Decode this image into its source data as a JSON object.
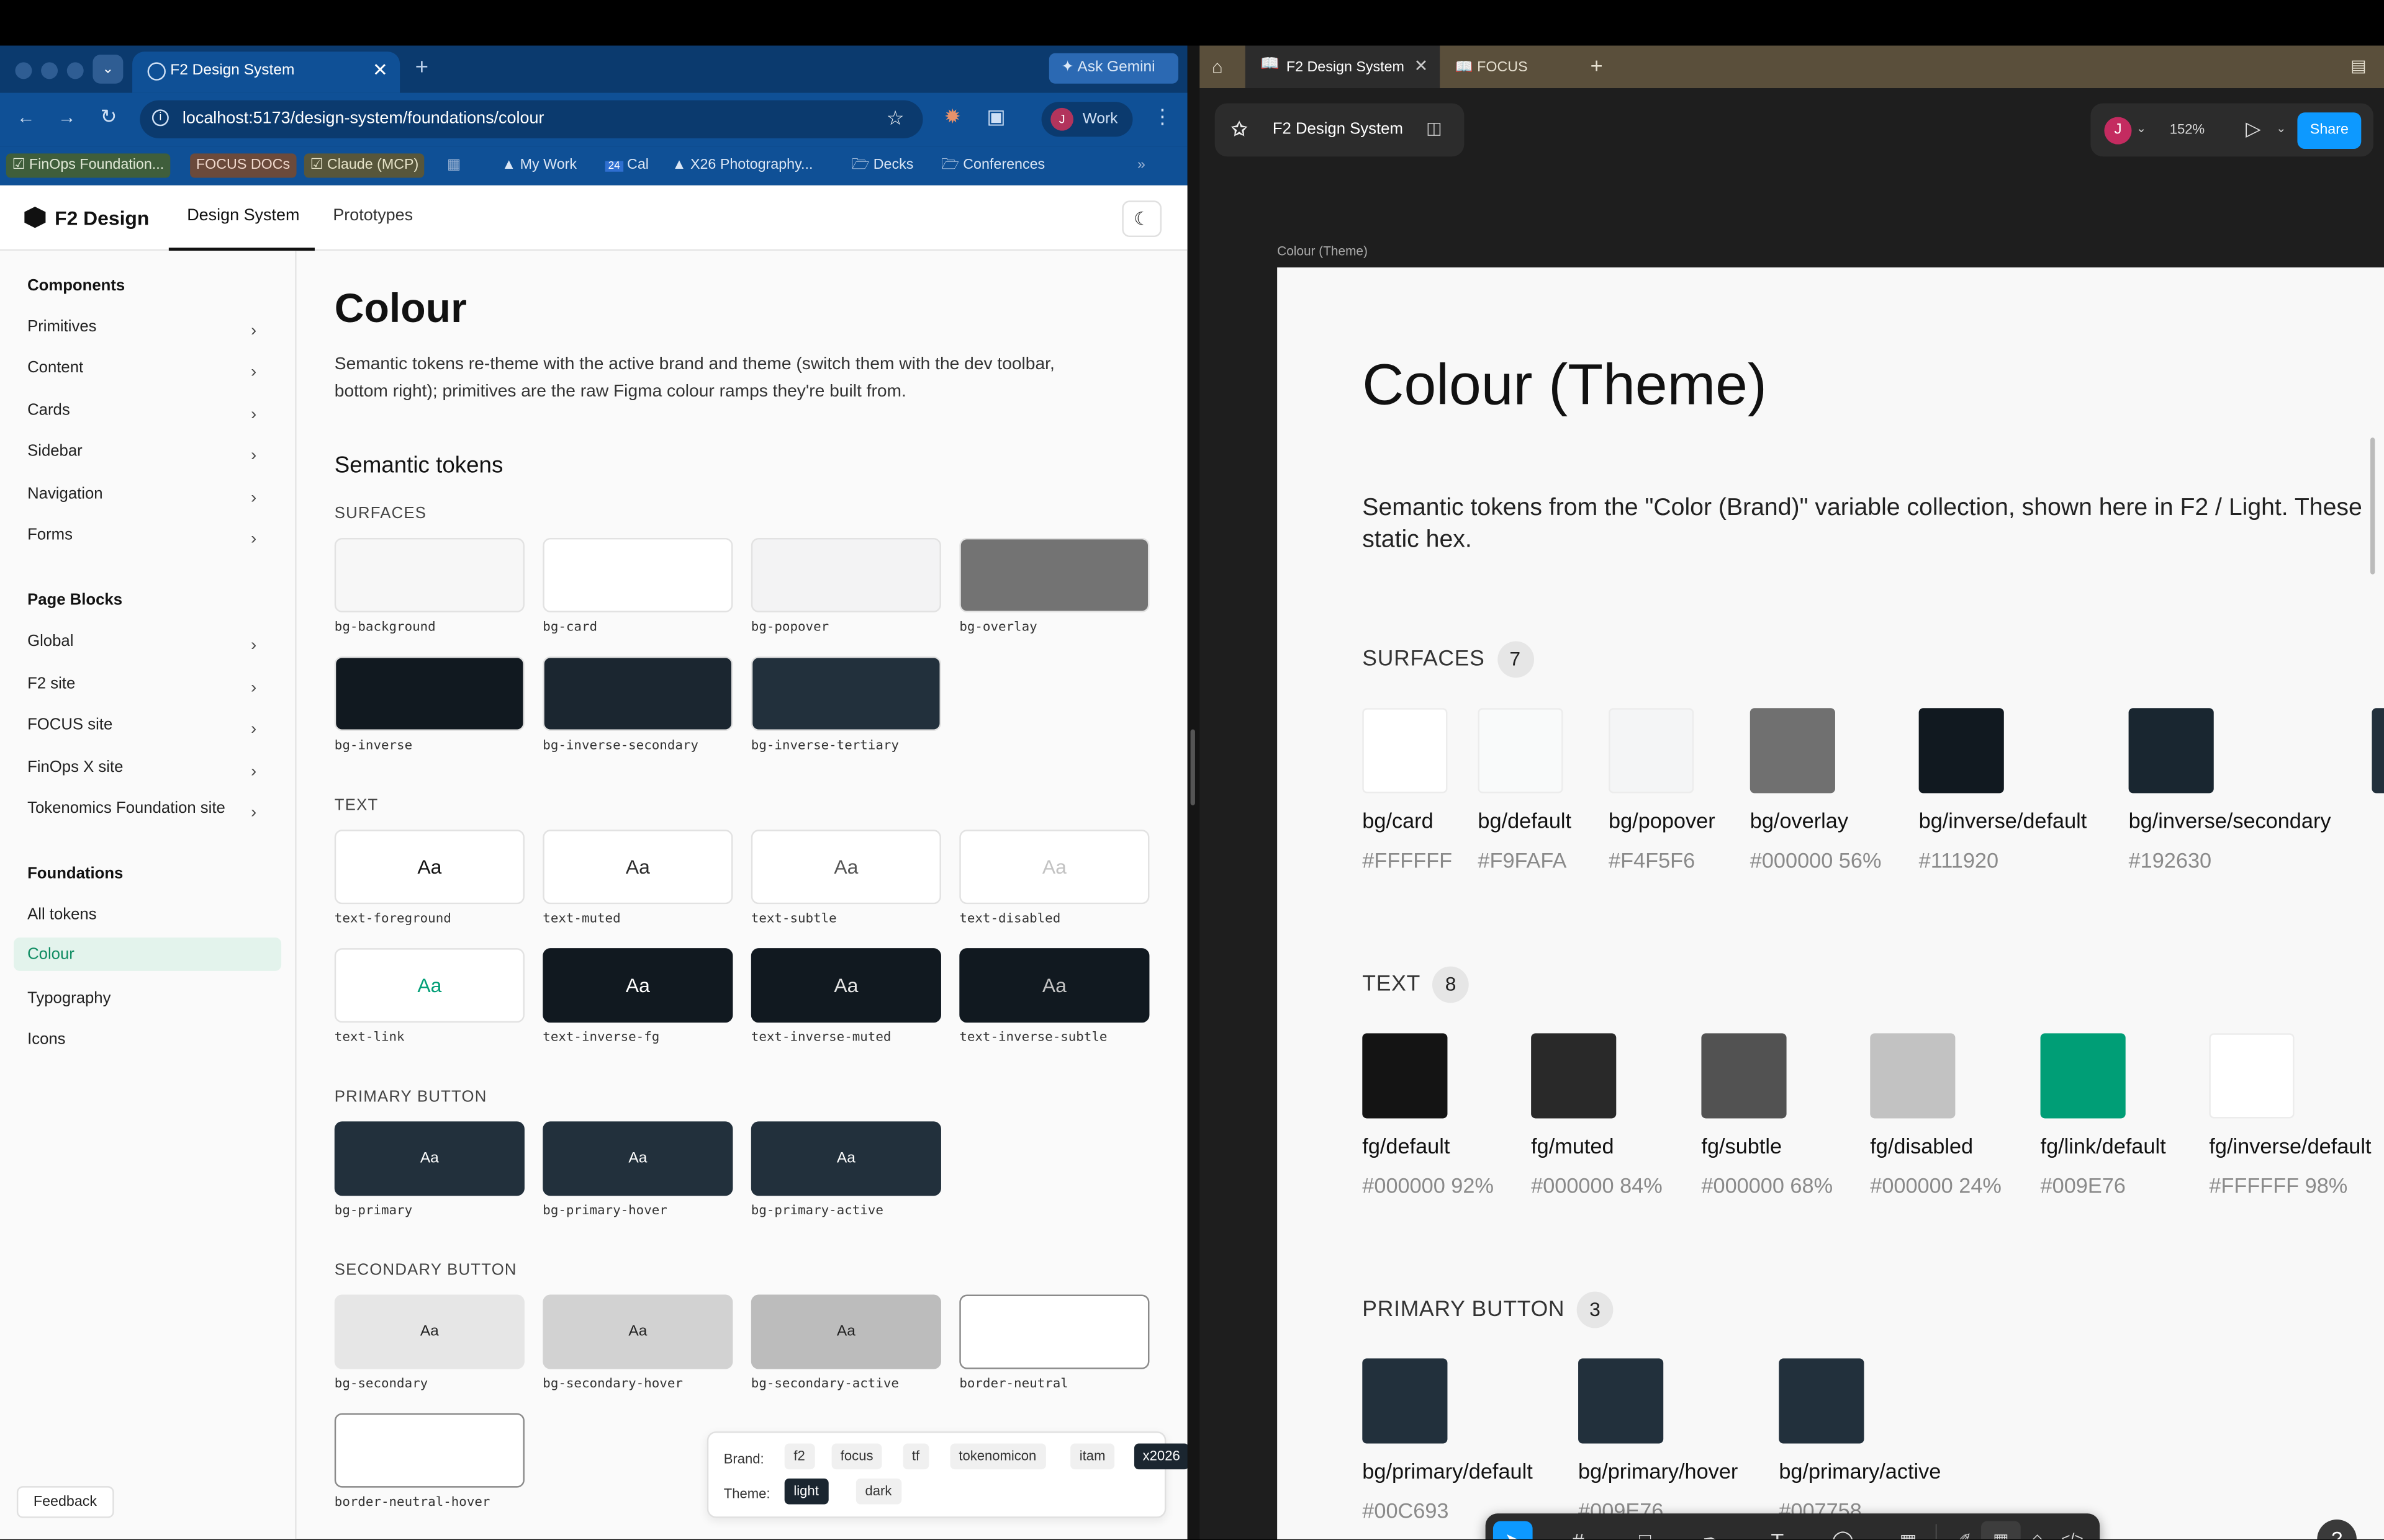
{
  "browser": {
    "tab_title": "F2 Design System",
    "ask_gemini": "Ask Gemini",
    "url": "localhost:5173/design-system/foundations/colour",
    "profile_initial": "J",
    "profile_label": "Work",
    "bookmarks": [
      "FinOps Foundation...",
      "FOCUS DOCs",
      "Claude (MCP)",
      "My Work",
      "Cal",
      "X26 Photography...",
      "Decks",
      "Conferences"
    ],
    "cal_badge": "24"
  },
  "app": {
    "logo_text": "F2 Design",
    "nav_tabs": [
      "Design System",
      "Prototypes"
    ]
  },
  "sidebar": {
    "components_heading": "Components",
    "components": [
      "Primitives",
      "Content",
      "Cards",
      "Sidebar",
      "Navigation",
      "Forms"
    ],
    "page_blocks_heading": "Page Blocks",
    "page_blocks": [
      "Global",
      "F2 site",
      "FOCUS site",
      "FinOps X site",
      "Tokenomics Foundation site"
    ],
    "foundations_heading": "Foundations",
    "foundations": [
      "All tokens",
      "Colour",
      "Typography",
      "Icons"
    ],
    "feedback": "Feedback"
  },
  "main": {
    "title": "Colour",
    "description": "Semantic tokens re-theme with the active brand and theme (switch them with the dev toolbar, bottom right); primitives are the raw Figma colour ramps they're built from.",
    "semantic_heading": "Semantic tokens",
    "surfaces_label": "SURFACES",
    "surfaces": [
      {
        "name": "bg-background",
        "color": "#f7f7f7"
      },
      {
        "name": "bg-card",
        "color": "#ffffff"
      },
      {
        "name": "bg-popover",
        "color": "#f3f3f4"
      },
      {
        "name": "bg-overlay",
        "color": "#737373"
      },
      {
        "name": "bg-inverse",
        "color": "#111920"
      },
      {
        "name": "bg-inverse-secondary",
        "color": "#1b2630"
      },
      {
        "name": "bg-inverse-tertiary",
        "color": "#22303c"
      }
    ],
    "text_label": "TEXT",
    "sample": "Aa",
    "text_tokens": [
      {
        "name": "text-foreground",
        "bg": "#ffffff",
        "fg": "#111111"
      },
      {
        "name": "text-muted",
        "bg": "#ffffff",
        "fg": "#2a2a2a"
      },
      {
        "name": "text-subtle",
        "bg": "#ffffff",
        "fg": "#555555"
      },
      {
        "name": "text-disabled",
        "bg": "#ffffff",
        "fg": "#c2c2c2"
      },
      {
        "name": "text-link",
        "bg": "#ffffff",
        "fg": "#009e76"
      },
      {
        "name": "text-inverse-fg",
        "bg": "#111920",
        "fg": "#ffffff"
      },
      {
        "name": "text-inverse-muted",
        "bg": "#111920",
        "fg": "#e6e6e6"
      },
      {
        "name": "text-inverse-subtle",
        "bg": "#111920",
        "fg": "#c4c4c4"
      }
    ],
    "primary_label": "PRIMARY BUTTON",
    "primary": [
      {
        "name": "bg-primary",
        "color": "#22303c"
      },
      {
        "name": "bg-primary-hover",
        "color": "#22303c"
      },
      {
        "name": "bg-primary-active",
        "color": "#22303c"
      }
    ],
    "secondary_label": "SECONDARY BUTTON",
    "secondary": [
      {
        "name": "bg-secondary",
        "color": "#e6e6e6"
      },
      {
        "name": "bg-secondary-hover",
        "color": "#d2d2d2"
      },
      {
        "name": "bg-secondary-active",
        "color": "#bcbcbc"
      },
      {
        "name": "border-neutral",
        "color": "#ffffff"
      },
      {
        "name": "border-neutral-hover",
        "color": "#ffffff"
      }
    ]
  },
  "devbar": {
    "brand_label": "Brand:",
    "brands": [
      "f2",
      "focus",
      "tf",
      "tokenomicon",
      "itam",
      "x2026"
    ],
    "active_brand": "x2026",
    "theme_label": "Theme:",
    "themes": [
      "light",
      "dark"
    ],
    "active_theme": "light"
  },
  "figma": {
    "tabs": [
      "F2 Design System",
      "FOCUS"
    ],
    "file_name": "F2 Design System",
    "avatar_initial": "J",
    "zoom": "152%",
    "share": "Share",
    "frame_label": "Colour (Theme)",
    "title": "Colour (Theme)",
    "description": "Semantic tokens from the \"Color (Brand)\" variable collection, shown here in F2 / Light. These",
    "description2": "static hex.",
    "surfaces_label": "SURFACES",
    "surfaces_count": "7",
    "surfaces": [
      {
        "name": "bg/card",
        "hex": "#FFFFFF",
        "color": "#ffffff"
      },
      {
        "name": "bg/default",
        "hex": "#F9FAFA",
        "color": "#f9fafa"
      },
      {
        "name": "bg/popover",
        "hex": "#F4F5F6",
        "color": "#f4f5f6"
      },
      {
        "name": "bg/overlay",
        "hex": "#000000 56%",
        "color": "#707070"
      },
      {
        "name": "bg/inverse/default",
        "hex": "#111920",
        "color": "#111920"
      },
      {
        "name": "bg/inverse/secondary",
        "hex": "#192630",
        "color": "#192630"
      }
    ],
    "text_label": "TEXT",
    "text_count": "8",
    "text_tokens": [
      {
        "name": "fg/default",
        "hex": "#000000 92%",
        "color": "#141414"
      },
      {
        "name": "fg/muted",
        "hex": "#000000 84%",
        "color": "#292929"
      },
      {
        "name": "fg/subtle",
        "hex": "#000000 68%",
        "color": "#525252"
      },
      {
        "name": "fg/disabled",
        "hex": "#000000 24%",
        "color": "#c2c2c2"
      },
      {
        "name": "fg/link/default",
        "hex": "#009E76",
        "color": "#009e76"
      },
      {
        "name": "fg/inverse/default",
        "hex": "#FFFFFF 98%",
        "color": "#ffffff"
      }
    ],
    "primary_label": "PRIMARY BUTTON",
    "primary_count": "3",
    "primary": [
      {
        "name": "bg/primary/default",
        "hex": "#00C693",
        "color": "#22303c"
      },
      {
        "name": "bg/primary/hover",
        "hex": "#009E76",
        "color": "#22303c"
      },
      {
        "name": "bg/primary/active",
        "hex": "#007758",
        "color": "#22303c"
      }
    ],
    "help": "?"
  }
}
